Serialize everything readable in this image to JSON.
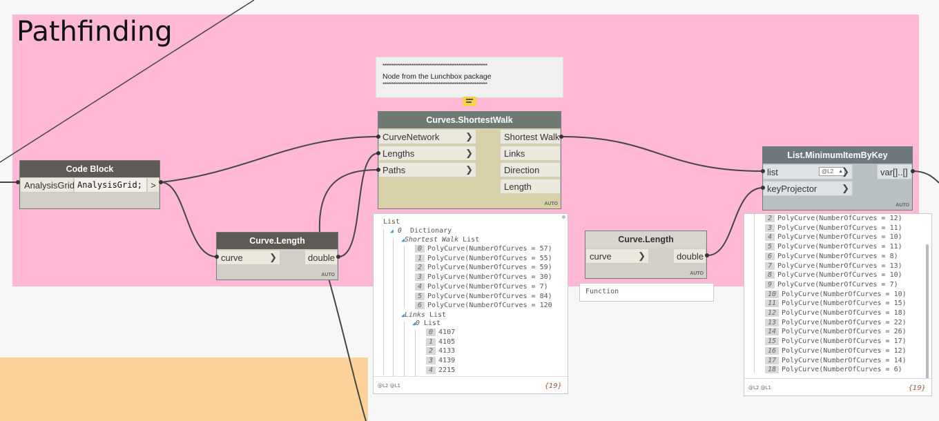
{
  "groups": {
    "pathfinding": {
      "title": "Pathfinding",
      "color": "#ffb8d6"
    },
    "orange": {
      "color": "#fcd29b"
    }
  },
  "note": {
    "stars": "**********************************************************",
    "text": "Node from the Lunchbox package"
  },
  "code_block": {
    "title": "Code Block",
    "input_label": "AnalysisGrid",
    "code": "AnalysisGrid;",
    "output": ">"
  },
  "shortest_walk": {
    "title": "Curves.ShortestWalk",
    "inputs": [
      "CurveNetwork",
      "Lengths",
      "Paths"
    ],
    "outputs": [
      "Shortest Walk",
      "Links",
      "Direction",
      "Length"
    ],
    "lacing": "AUTO"
  },
  "curve_length_1": {
    "title": "Curve.Length",
    "input": "curve",
    "output": "double",
    "lacing": "AUTO"
  },
  "curve_length_2": {
    "title": "Curve.Length",
    "input": "curve",
    "output": "double",
    "lacing": "AUTO",
    "function_label": "Function"
  },
  "min_item": {
    "title": "List.MinimumItemByKey",
    "inputs": [
      "list",
      "keyProjector"
    ],
    "list_level": "@L2",
    "output": "var[]..[]",
    "lacing": "AUTO"
  },
  "preview_walk": {
    "root": "List",
    "dict_index": "0",
    "dict_label": "Dictionary",
    "shortest_key": "Shortest Walk",
    "shortest_type": "List",
    "shortest_items": [
      {
        "i": "0",
        "v": "PolyCurve(NumberOfCurves = 57)"
      },
      {
        "i": "1",
        "v": "PolyCurve(NumberOfCurves = 55)"
      },
      {
        "i": "2",
        "v": "PolyCurve(NumberOfCurves = 59)"
      },
      {
        "i": "3",
        "v": "PolyCurve(NumberOfCurves = 30)"
      },
      {
        "i": "4",
        "v": "PolyCurve(NumberOfCurves = 7)"
      },
      {
        "i": "5",
        "v": "PolyCurve(NumberOfCurves = 84)"
      },
      {
        "i": "6",
        "v": "PolyCurve(NumberOfCurves = 120"
      }
    ],
    "links_key": "Links",
    "links_type": "List",
    "links_sub_index": "0",
    "links_sub_type": "List",
    "links_items": [
      {
        "i": "0",
        "v": "4107"
      },
      {
        "i": "1",
        "v": "4105"
      },
      {
        "i": "2",
        "v": "4133"
      },
      {
        "i": "3",
        "v": "4139"
      },
      {
        "i": "4",
        "v": "2215"
      }
    ],
    "levels": "@L2 @L1",
    "count": "{19}"
  },
  "preview_min": {
    "items": [
      {
        "i": "2",
        "v": "PolyCurve(NumberOfCurves = 12)"
      },
      {
        "i": "3",
        "v": "PolyCurve(NumberOfCurves = 11)"
      },
      {
        "i": "4",
        "v": "PolyCurve(NumberOfCurves = 10)"
      },
      {
        "i": "5",
        "v": "PolyCurve(NumberOfCurves = 11)"
      },
      {
        "i": "6",
        "v": "PolyCurve(NumberOfCurves = 8)"
      },
      {
        "i": "7",
        "v": "PolyCurve(NumberOfCurves = 13)"
      },
      {
        "i": "8",
        "v": "PolyCurve(NumberOfCurves = 10)"
      },
      {
        "i": "9",
        "v": "PolyCurve(NumberOfCurves = 7)"
      },
      {
        "i": "10",
        "v": "PolyCurve(NumberOfCurves = 10)"
      },
      {
        "i": "11",
        "v": "PolyCurve(NumberOfCurves = 15)"
      },
      {
        "i": "12",
        "v": "PolyCurve(NumberOfCurves = 18)"
      },
      {
        "i": "13",
        "v": "PolyCurve(NumberOfCurves = 22)"
      },
      {
        "i": "14",
        "v": "PolyCurve(NumberOfCurves = 26)"
      },
      {
        "i": "15",
        "v": "PolyCurve(NumberOfCurves = 17)"
      },
      {
        "i": "16",
        "v": "PolyCurve(NumberOfCurves = 12)"
      },
      {
        "i": "17",
        "v": "PolyCurve(NumberOfCurves = 14)"
      },
      {
        "i": "18",
        "v": "PolyCurve(NumberOfCurves = 6)"
      }
    ],
    "levels": "@L2 @L1",
    "count": "{19}"
  },
  "colors": {
    "node_header": "#5e5b57",
    "shortest_header": "#6f7a73",
    "shortest_body": "#d8d1a8",
    "min_header": "#6d7880",
    "min_body": "#b8c0c4",
    "node_body": "#d2cec8",
    "wire": "#444444"
  }
}
